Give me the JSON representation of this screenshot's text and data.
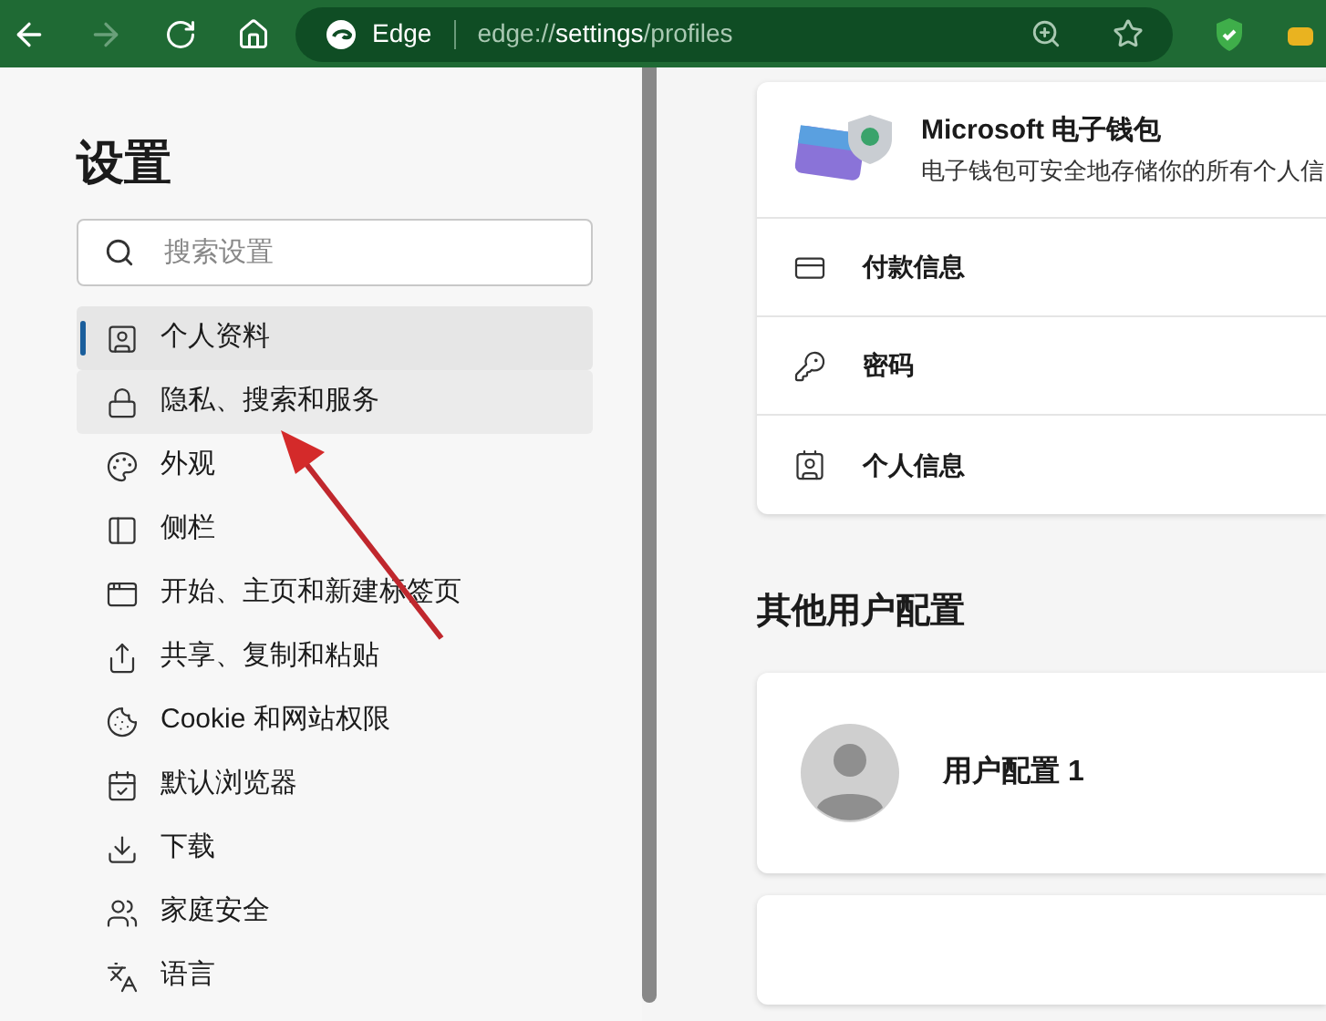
{
  "toolbar": {
    "browser_name": "Edge",
    "address_prefix": "edge://",
    "address_host": "settings",
    "address_path": "/profiles"
  },
  "sidebar": {
    "title": "设置",
    "search": {
      "placeholder": "搜索设置"
    },
    "items": [
      {
        "label": "个人资料",
        "selected": true,
        "hovered": false
      },
      {
        "label": "隐私、搜索和服务",
        "selected": false,
        "hovered": true
      },
      {
        "label": "外观",
        "selected": false,
        "hovered": false
      },
      {
        "label": "侧栏",
        "selected": false,
        "hovered": false
      },
      {
        "label": "开始、主页和新建标签页",
        "selected": false,
        "hovered": false
      },
      {
        "label": "共享、复制和粘贴",
        "selected": false,
        "hovered": false
      },
      {
        "label": "Cookie 和网站权限",
        "selected": false,
        "hovered": false
      },
      {
        "label": "默认浏览器",
        "selected": false,
        "hovered": false
      },
      {
        "label": "下载",
        "selected": false,
        "hovered": false
      },
      {
        "label": "家庭安全",
        "selected": false,
        "hovered": false
      },
      {
        "label": "语言",
        "selected": false,
        "hovered": false
      }
    ]
  },
  "wallet": {
    "title": "Microsoft 电子钱包",
    "description": "电子钱包可安全地存储你的所有个人信",
    "rows": [
      {
        "label": "付款信息"
      },
      {
        "label": "密码"
      },
      {
        "label": "个人信息"
      }
    ]
  },
  "other_profiles": {
    "heading": "其他用户配置",
    "profiles": [
      {
        "name": "用户配置 1"
      }
    ]
  }
}
